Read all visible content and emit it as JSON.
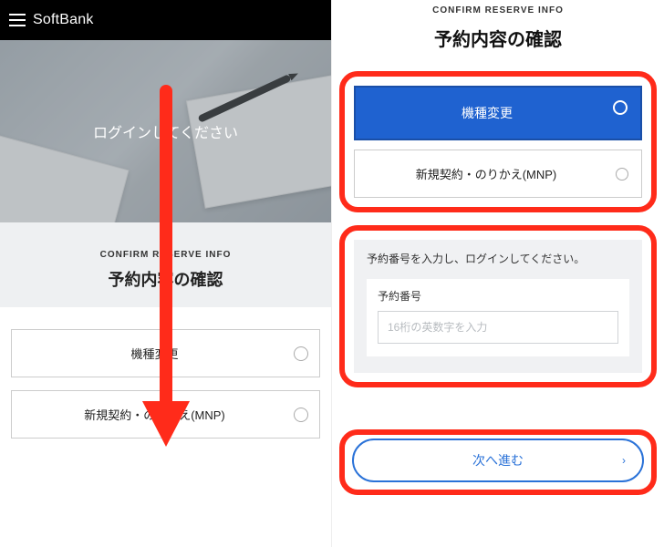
{
  "brand": "SoftBank",
  "hero": {
    "login_prompt": "ログインしてください"
  },
  "confirm": {
    "eyebrow": "CONFIRM RESERVE INFO",
    "title": "予約内容の確認"
  },
  "options": {
    "model_change": "機種変更",
    "new_mnp": "新規契約・のりかえ(MNP)"
  },
  "login_box": {
    "instruction": "予約番号を入力し、ログインしてください。",
    "field_label": "予約番号",
    "placeholder": "16桁の英数字を入力"
  },
  "proceed": {
    "label": "次へ進む"
  },
  "colors": {
    "accent_blue": "#1f62d0",
    "annotation_red": "#ff2b1a"
  }
}
